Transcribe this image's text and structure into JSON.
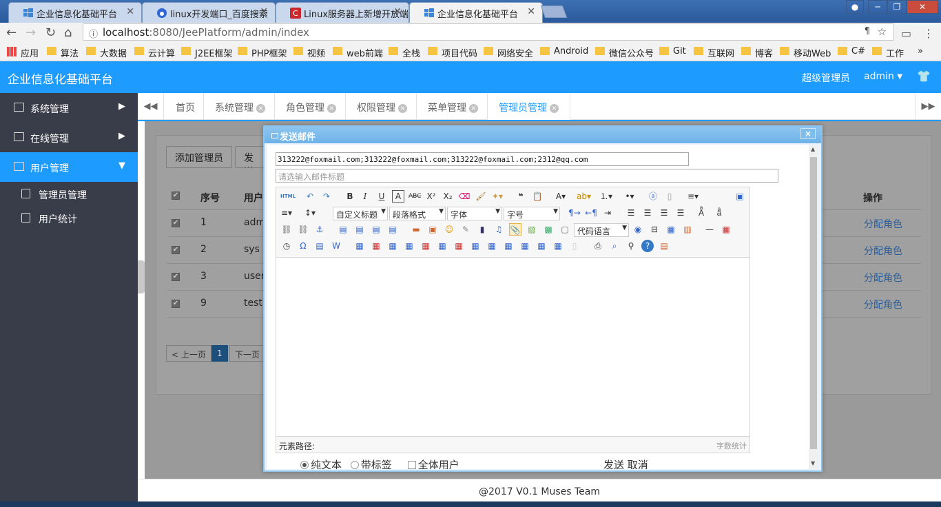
{
  "browser": {
    "tabs": [
      {
        "title": "企业信息化基础平台",
        "active": false
      },
      {
        "title": "linux开发端口_百度搜索",
        "active": false
      },
      {
        "title": "Linux服务器上新增开放端",
        "active": false
      },
      {
        "title": "企业信息化基础平台",
        "active": true
      }
    ],
    "url_host": "localhost",
    "url_rest": ":8080/JeePlatform/admin/index",
    "bookmarks": [
      "应用",
      "算法",
      "大数据",
      "云计算",
      "J2EE框架",
      "PHP框架",
      "视频",
      "web前端",
      "全栈",
      "项目代码",
      "网络安全",
      "Android",
      "微信公众号",
      "Git",
      "互联网",
      "博客",
      "移动Web",
      "C#",
      "工作"
    ],
    "more": "»"
  },
  "app": {
    "title": "企业信息化基础平台",
    "role": "超级管理员",
    "user": "admin",
    "user_caret": "▼"
  },
  "sidebar": {
    "menus": [
      {
        "label": "系统管理",
        "arrow": "▶"
      },
      {
        "label": "在线管理",
        "arrow": "▶"
      },
      {
        "label": "用户管理",
        "arrow": "▼"
      }
    ],
    "submenu": [
      "管理员管理",
      "用户统计"
    ]
  },
  "tabnav": {
    "left": "◀◀",
    "right": "▶▶",
    "tabs": [
      "首页",
      "系统管理",
      "角色管理",
      "权限管理",
      "菜单管理",
      "管理员管理"
    ],
    "close": "×"
  },
  "page": {
    "add_button": "添加管理员",
    "send_button": "发送",
    "headers": {
      "no": "序号",
      "user": "用户",
      "op": "操作"
    },
    "rows": [
      {
        "no": "1",
        "user": "adm",
        "op": "分配角色"
      },
      {
        "no": "2",
        "user": "sys",
        "op": "分配角色"
      },
      {
        "no": "3",
        "user": "user",
        "op": "分配角色"
      },
      {
        "no": "9",
        "user": "test",
        "op": "分配角色"
      }
    ],
    "prev": "< 上一页",
    "page_num": "1",
    "next": "下一页 >",
    "footer": "@2017 V0.1 Muses Team"
  },
  "dialog": {
    "title": "发送邮件",
    "close": "×",
    "to": "313222@foxmail.com;313222@foxmail.com;313222@foxmail.com;2312@qq.com",
    "subject_placeholder": "请选输入邮件标题",
    "dropdowns": {
      "title": "自定义标题",
      "para": "段落格式",
      "font": "字体",
      "size": "字号",
      "code": "代码语言"
    },
    "element_path": "元素路径:",
    "word_count": "字数统计",
    "options": {
      "plain": "纯文本",
      "tagged": "带标签",
      "all_users": "全体用户"
    },
    "send": "发送",
    "cancel": "取消"
  },
  "colors": {
    "primary": "#1e9bff",
    "sidebar": "#393d49"
  }
}
